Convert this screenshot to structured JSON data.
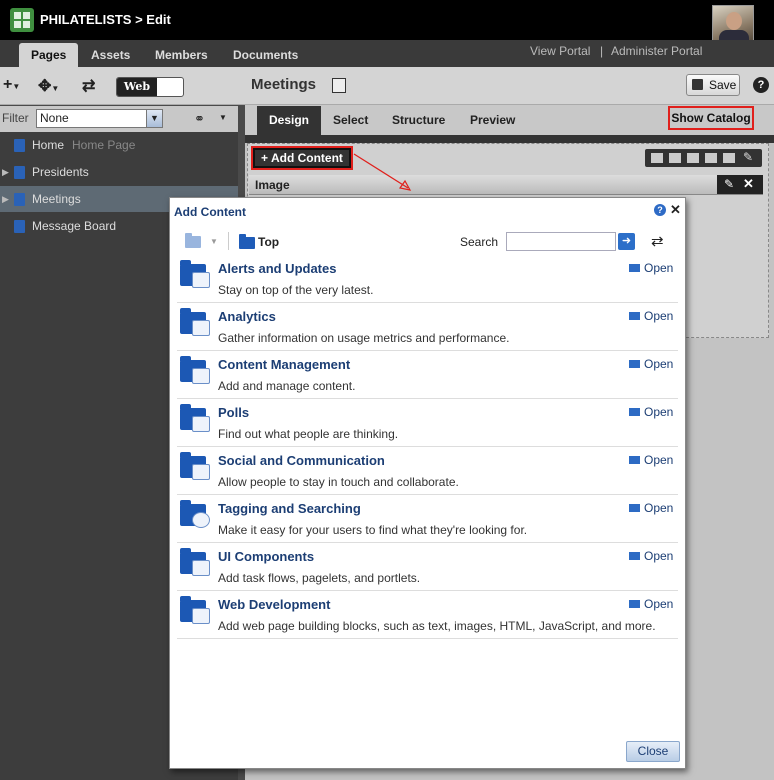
{
  "header": {
    "app_title": "PHILATELISTS > Edit",
    "avatar": "user-avatar"
  },
  "nav": {
    "tabs": [
      "Pages",
      "Assets",
      "Members",
      "Documents"
    ],
    "active_tab": "Pages",
    "links": [
      "View Portal",
      "|",
      "Administer Portal"
    ]
  },
  "toolbar": {
    "web_toggle_label": "Web",
    "page_name": "Meetings",
    "save_label": "Save",
    "help_label": "?"
  },
  "filter": {
    "label": "Filter",
    "value": "None"
  },
  "sidebar": {
    "items": [
      {
        "label": "Home",
        "suffix": "Home Page",
        "selected": false
      },
      {
        "label": "Presidents",
        "selected": false
      },
      {
        "label": "Meetings",
        "selected": true
      },
      {
        "label": "Message Board",
        "selected": false
      }
    ]
  },
  "design_tabs": {
    "tabs": [
      "Design",
      "Select",
      "Structure",
      "Preview"
    ],
    "active": "Design",
    "show_catalog": "Show Catalog"
  },
  "canvas": {
    "add_content_label": "+ Add Content",
    "image_region_label": "Image"
  },
  "dialog": {
    "title": "Add Content",
    "help": "?",
    "close_x": "✕",
    "breadcrumb_top": "Top",
    "search_label": "Search",
    "search_value": "",
    "open_label": "Open",
    "close_button": "Close",
    "categories": [
      {
        "title": "Alerts and Updates",
        "description": "Stay on top of the very latest."
      },
      {
        "title": "Analytics",
        "description": "Gather information on usage metrics and performance."
      },
      {
        "title": "Content Management",
        "description": "Add and manage content."
      },
      {
        "title": "Polls",
        "description": "Find out what people are thinking."
      },
      {
        "title": "Social and Communication",
        "description": "Allow people to stay in touch and collaborate."
      },
      {
        "title": "Tagging and Searching",
        "description": "Make it easy for your users to find what they're looking for."
      },
      {
        "title": "UI Components",
        "description": "Add task flows, pagelets, and portlets."
      },
      {
        "title": "Web Development",
        "description": "Add web page building blocks, such as text, images, HTML, JavaScript, and more."
      }
    ]
  },
  "colors": {
    "accent_red": "#e0201c",
    "link_blue": "#1c3e74",
    "folder_blue": "#1c58b4"
  }
}
